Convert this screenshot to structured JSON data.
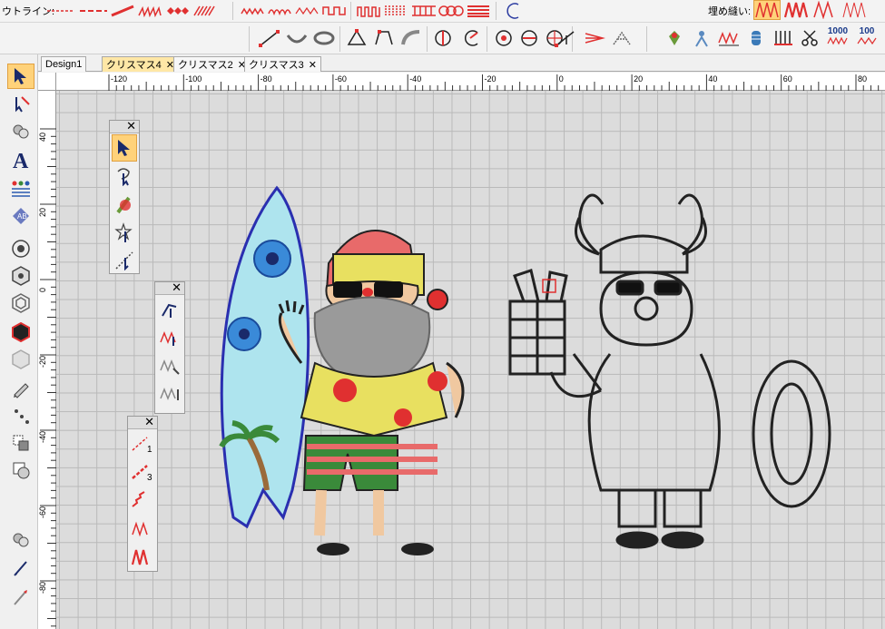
{
  "toolbar": {
    "outline_label": "ウトライン:",
    "fill_label": "埋め縫い:",
    "fill_1000": "1000",
    "fill_100": "100"
  },
  "tabs": [
    {
      "label": "Design1",
      "active": false
    },
    {
      "label": "クリスマス4",
      "active": true
    },
    {
      "label": "クリスマス2",
      "active": false
    },
    {
      "label": "クリスマス3",
      "active": false
    }
  ],
  "tab_close": "✕",
  "ruler": {
    "h_ticks": [
      "-120",
      "-100",
      "-80",
      "-60",
      "-40",
      "-20",
      "0",
      "20",
      "40",
      "60",
      "80"
    ],
    "v_ticks": [
      "40",
      "20",
      "0",
      "-20",
      "-40",
      "-60",
      "-80"
    ]
  },
  "palettes": {
    "close": "✕",
    "stitch_1": "1",
    "stitch_3": "3"
  },
  "colors": {
    "accent_red": "#e03030",
    "tab_active": "#ffe7a6",
    "toolbar_highlight": "#ffd27a",
    "surfboard_blue": "#2a2fb0",
    "santa_hat": "#e86a6a"
  }
}
